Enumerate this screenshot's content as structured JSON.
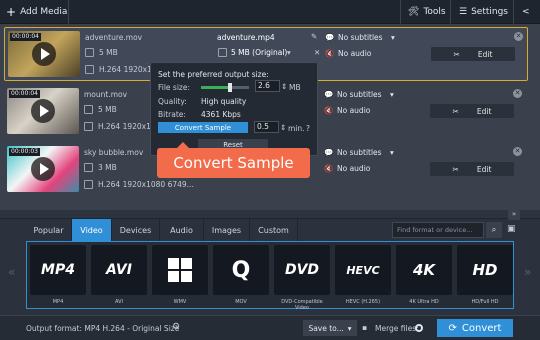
{
  "toolbar": {
    "add_media": "Add Media",
    "tools": "Tools",
    "settings": "Settings"
  },
  "files": [
    {
      "timecode": "00:00:04",
      "name": "adventure.mov",
      "size": "5 MB",
      "codec": "H.264 1920x108...",
      "out_name": "adventure.mp4",
      "out_size": "5 MB (Original)",
      "subtitles": "No subtitles",
      "audio": "No audio",
      "edit": "Edit"
    },
    {
      "timecode": "00:00:04",
      "name": "mount.mov",
      "size": "5 MB",
      "codec": "H.264 1920x108...",
      "subtitles": "No subtitles",
      "audio": "No audio",
      "edit": "Edit"
    },
    {
      "timecode": "00:00:03",
      "name": "sky bubble.mov",
      "size": "3 MB",
      "codec": "H.264 1920x1080 6749...",
      "subtitles": "No subtitles",
      "audio": "No audio",
      "edit": "Edit"
    }
  ],
  "popup": {
    "heading": "Set the preferred output size:",
    "file_size_label": "File size:",
    "file_size_value": "2.6",
    "file_size_unit": "MB",
    "quality_label": "Quality:",
    "quality_value": "High quality",
    "bitrate_label": "Bitrate:",
    "bitrate_value": "4361 Kbps",
    "convert_sample": "Convert Sample",
    "sample_len": "0.5",
    "sample_unit": "min.",
    "reset": "Reset",
    "help": "?",
    "slider_fraction": 0.6
  },
  "tooltip": "Convert Sample",
  "tabs": [
    "Popular",
    "Video",
    "Devices",
    "Audio",
    "Images",
    "Custom"
  ],
  "search_placeholder": "Find format or device...",
  "formats": [
    {
      "logo": "MP4",
      "label": "MP4"
    },
    {
      "logo": "AVI",
      "label": "AVI"
    },
    {
      "logo": "WMV",
      "label": "WMV"
    },
    {
      "logo": "Q",
      "label": "MOV"
    },
    {
      "logo": "DVD",
      "label": "DVD-Compatible Video"
    },
    {
      "logo": "HEVC",
      "label": "HEVC (H.265)"
    },
    {
      "logo": "4K",
      "label": "4K Ultra HD"
    },
    {
      "logo": "HD",
      "label": "HD/Full HD"
    }
  ],
  "footer": {
    "output_format": "Output format: MP4 H.264 - Original Size",
    "save_to": "Save to...",
    "merge_files": "Merge files:",
    "convert": "Convert"
  },
  "colors": {
    "accent": "#2f8fd7",
    "tooltip": "#f26b4b",
    "selected_border": "#d9a930"
  }
}
